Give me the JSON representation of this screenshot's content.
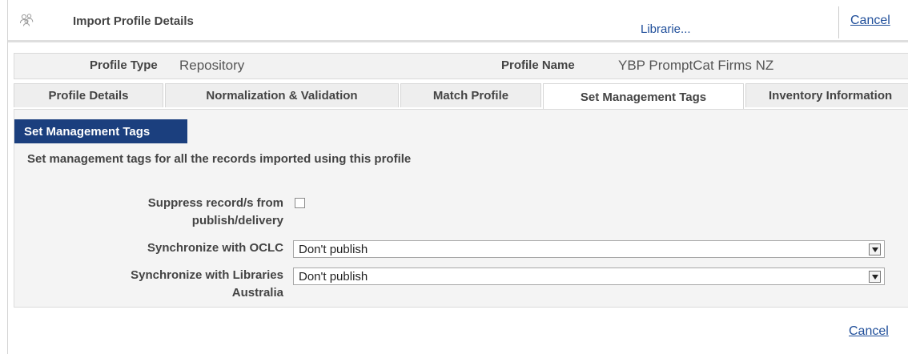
{
  "header": {
    "title": "Import Profile Details",
    "libraries_link": "Librarie...",
    "cancel_label": "Cancel",
    "icon": "people-group-icon"
  },
  "profile": {
    "type_label": "Profile Type",
    "type_value": "Repository",
    "name_label": "Profile Name",
    "name_value": "YBP PromptCat Firms NZ"
  },
  "tabs": [
    {
      "label": "Profile Details",
      "active": false
    },
    {
      "label": "Normalization & Validation",
      "active": false
    },
    {
      "label": "Match Profile",
      "active": false
    },
    {
      "label": "Set Management Tags",
      "active": true
    },
    {
      "label": "Inventory Information",
      "active": false
    }
  ],
  "section": {
    "title": "Set Management Tags",
    "description": "Set management tags for all the records imported using this profile"
  },
  "form": {
    "suppress_label_line1": "Suppress record/s from",
    "suppress_label_line2": "publish/delivery",
    "suppress_checked": false,
    "oclc_label": "Synchronize with OCLC",
    "oclc_value": "Don't publish",
    "la_label_line1": "Synchronize with Libraries",
    "la_label_line2": "Australia",
    "la_value": "Don't publish"
  },
  "footer": {
    "cancel_label": "Cancel"
  },
  "colors": {
    "accent": "#1b3f7e",
    "link": "#1f4e9a"
  }
}
